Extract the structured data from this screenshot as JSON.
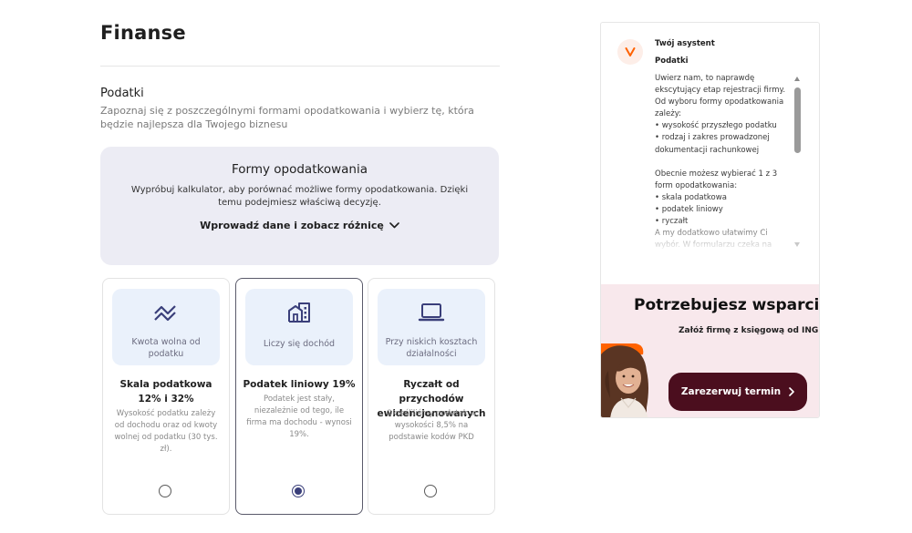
{
  "page": {
    "title": "Finanse",
    "section_title": "Podatki",
    "section_description": "Zapoznaj się z poszczególnymi formami opodatkowania i wybierz tę, która będzie najlepsza dla Twojego biznesu"
  },
  "calculator": {
    "title": "Formy opodatkowania",
    "description": "Wypróbuj kalkulator, aby porównać możliwe formy opodatkowania. Dzięki temu podejmiesz właściwą decyzję.",
    "cta_label": "Wprowadź dane i zobacz różnicę",
    "cta_icon": "chevron-down-icon"
  },
  "tax_options": [
    {
      "icon": "trend-down-icon",
      "tag": "Kwota wolna od podatku",
      "title": "Skala podatkowa 12% i 32%",
      "description": "Wysokość podatku zależy od dochodu oraz od kwoty wolnej od podatku (30 tys. zł).",
      "selected": false
    },
    {
      "icon": "building-icon",
      "tag": "Liczy się dochód",
      "title": "Podatek liniowy 19%",
      "description": "Podatek jest stały, niezależnie od tego, ile firma ma dochodu - wynosi 19%.",
      "selected": true
    },
    {
      "icon": "laptop-icon",
      "tag": "Przy niskich kosztach działalności",
      "title": "Ryczałt od przychodów ewidencjonowanych",
      "description": "Określiliśmy podatek w wysokości 8,5% na podstawie kodów PKD",
      "selected": false
    }
  ],
  "assistant": {
    "name": "Twój asystent",
    "topic": "Podatki",
    "message": "Uwierz nam, to naprawdę ekscytujący etap rejestracji firmy. Od wyboru formy opodatkowania zależy:\n• wysokość przyszłego podatku\n• rodzaj i zakres prowadzonej dokumentacji rachunkowej\n\nObecnie możesz wybierać 1 z 3 form opodatkowania:\n• skala podatkowa\n• podatek liniowy\n• ryczałt\nA my dodatkowo ułatwimy Ci wybór. W formularzu czeka na"
  },
  "promo": {
    "title": "Potrzebujesz wsparcia?",
    "subtitle": "Załóż firmę z księgową od ING",
    "button_label": "Zarezerwuj termin",
    "button_icon": "chevron-right-icon"
  },
  "colors": {
    "accent": "#3a3f7a",
    "card_top_bg": "#eaf1fb",
    "calc_bg": "#ececf4",
    "promo_bg": "#f8e8ec",
    "promo_button": "#4b0e1e",
    "ing_orange": "#ff6200"
  }
}
